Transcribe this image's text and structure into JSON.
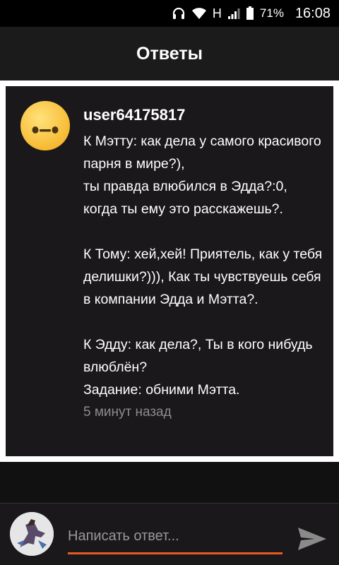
{
  "status_bar": {
    "network_label": "H",
    "battery": "71%",
    "time": "16:08"
  },
  "header": {
    "title": "Ответы"
  },
  "post": {
    "username": "user64175817",
    "message": "К Мэтту:  как дела у самого красивого парня в мире?),\nты правда влюбился в Эдда?:0, когда ты ему это расскажешь?.\n\nК Тому: хей,хей! Приятель, как у тебя делишки?))), Как ты чувствуешь себя в компании Эдда и Мэтта?.\n\nК Эдду: как дела?, Ты в кого нибудь влюблён?\nЗадание: обними Мэтта.",
    "time_ago": "5 минут назад"
  },
  "composer": {
    "placeholder": "Написать ответ..."
  },
  "colors": {
    "accent": "#e85b23",
    "background": "#111111",
    "card": "#1a181a",
    "header": "#1c1b1c",
    "muted_text": "#8c8c8c"
  }
}
